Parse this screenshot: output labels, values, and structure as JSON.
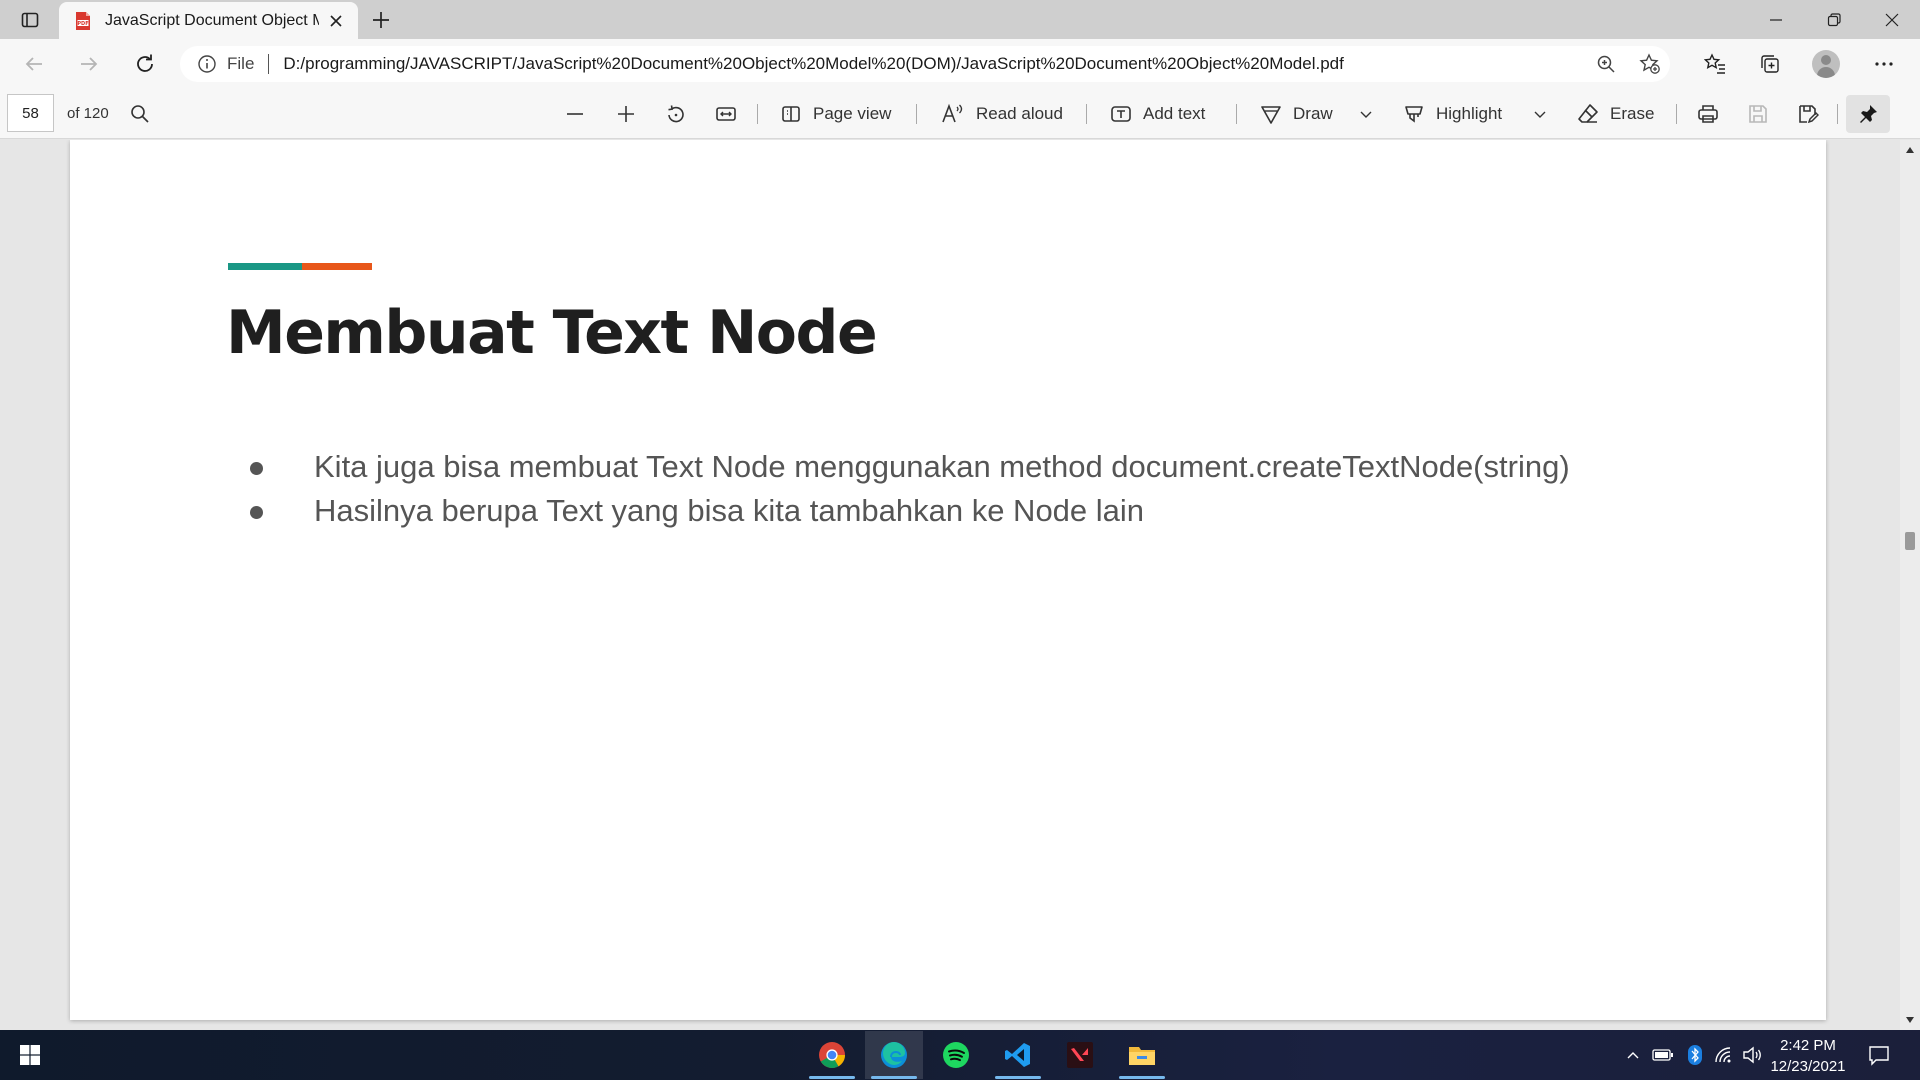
{
  "browser": {
    "tab": {
      "title": "JavaScript Document Object Mo",
      "favicon": "pdf-icon"
    },
    "address": {
      "scheme": "File",
      "url": "D:/programming/JAVASCRIPT/JavaScript%20Document%20Object%20Model%20(DOM)/JavaScript%20Document%20Object%20Model.pdf"
    }
  },
  "pdf_toolbar": {
    "current_page": "58",
    "total_pages": "of 120",
    "page_view": "Page view",
    "read_aloud": "Read aloud",
    "add_text": "Add text",
    "draw": "Draw",
    "highlight": "Highlight",
    "erase": "Erase"
  },
  "document": {
    "title": "Membuat Text Node",
    "bullets": [
      "Kita juga bisa membuat Text Node menggunakan method document.createTextNode(string)",
      "Hasilnya berupa Text yang bisa kita tambahkan ke Node lain"
    ],
    "accent_colors": [
      "#1a9785",
      "#e8571a"
    ]
  },
  "taskbar": {
    "apps": [
      "chrome-icon",
      "edge-icon",
      "spotify-icon",
      "vscode-icon",
      "valorant-icon",
      "file-explorer-icon"
    ],
    "time": "2:42 PM",
    "date": "12/23/2021"
  }
}
